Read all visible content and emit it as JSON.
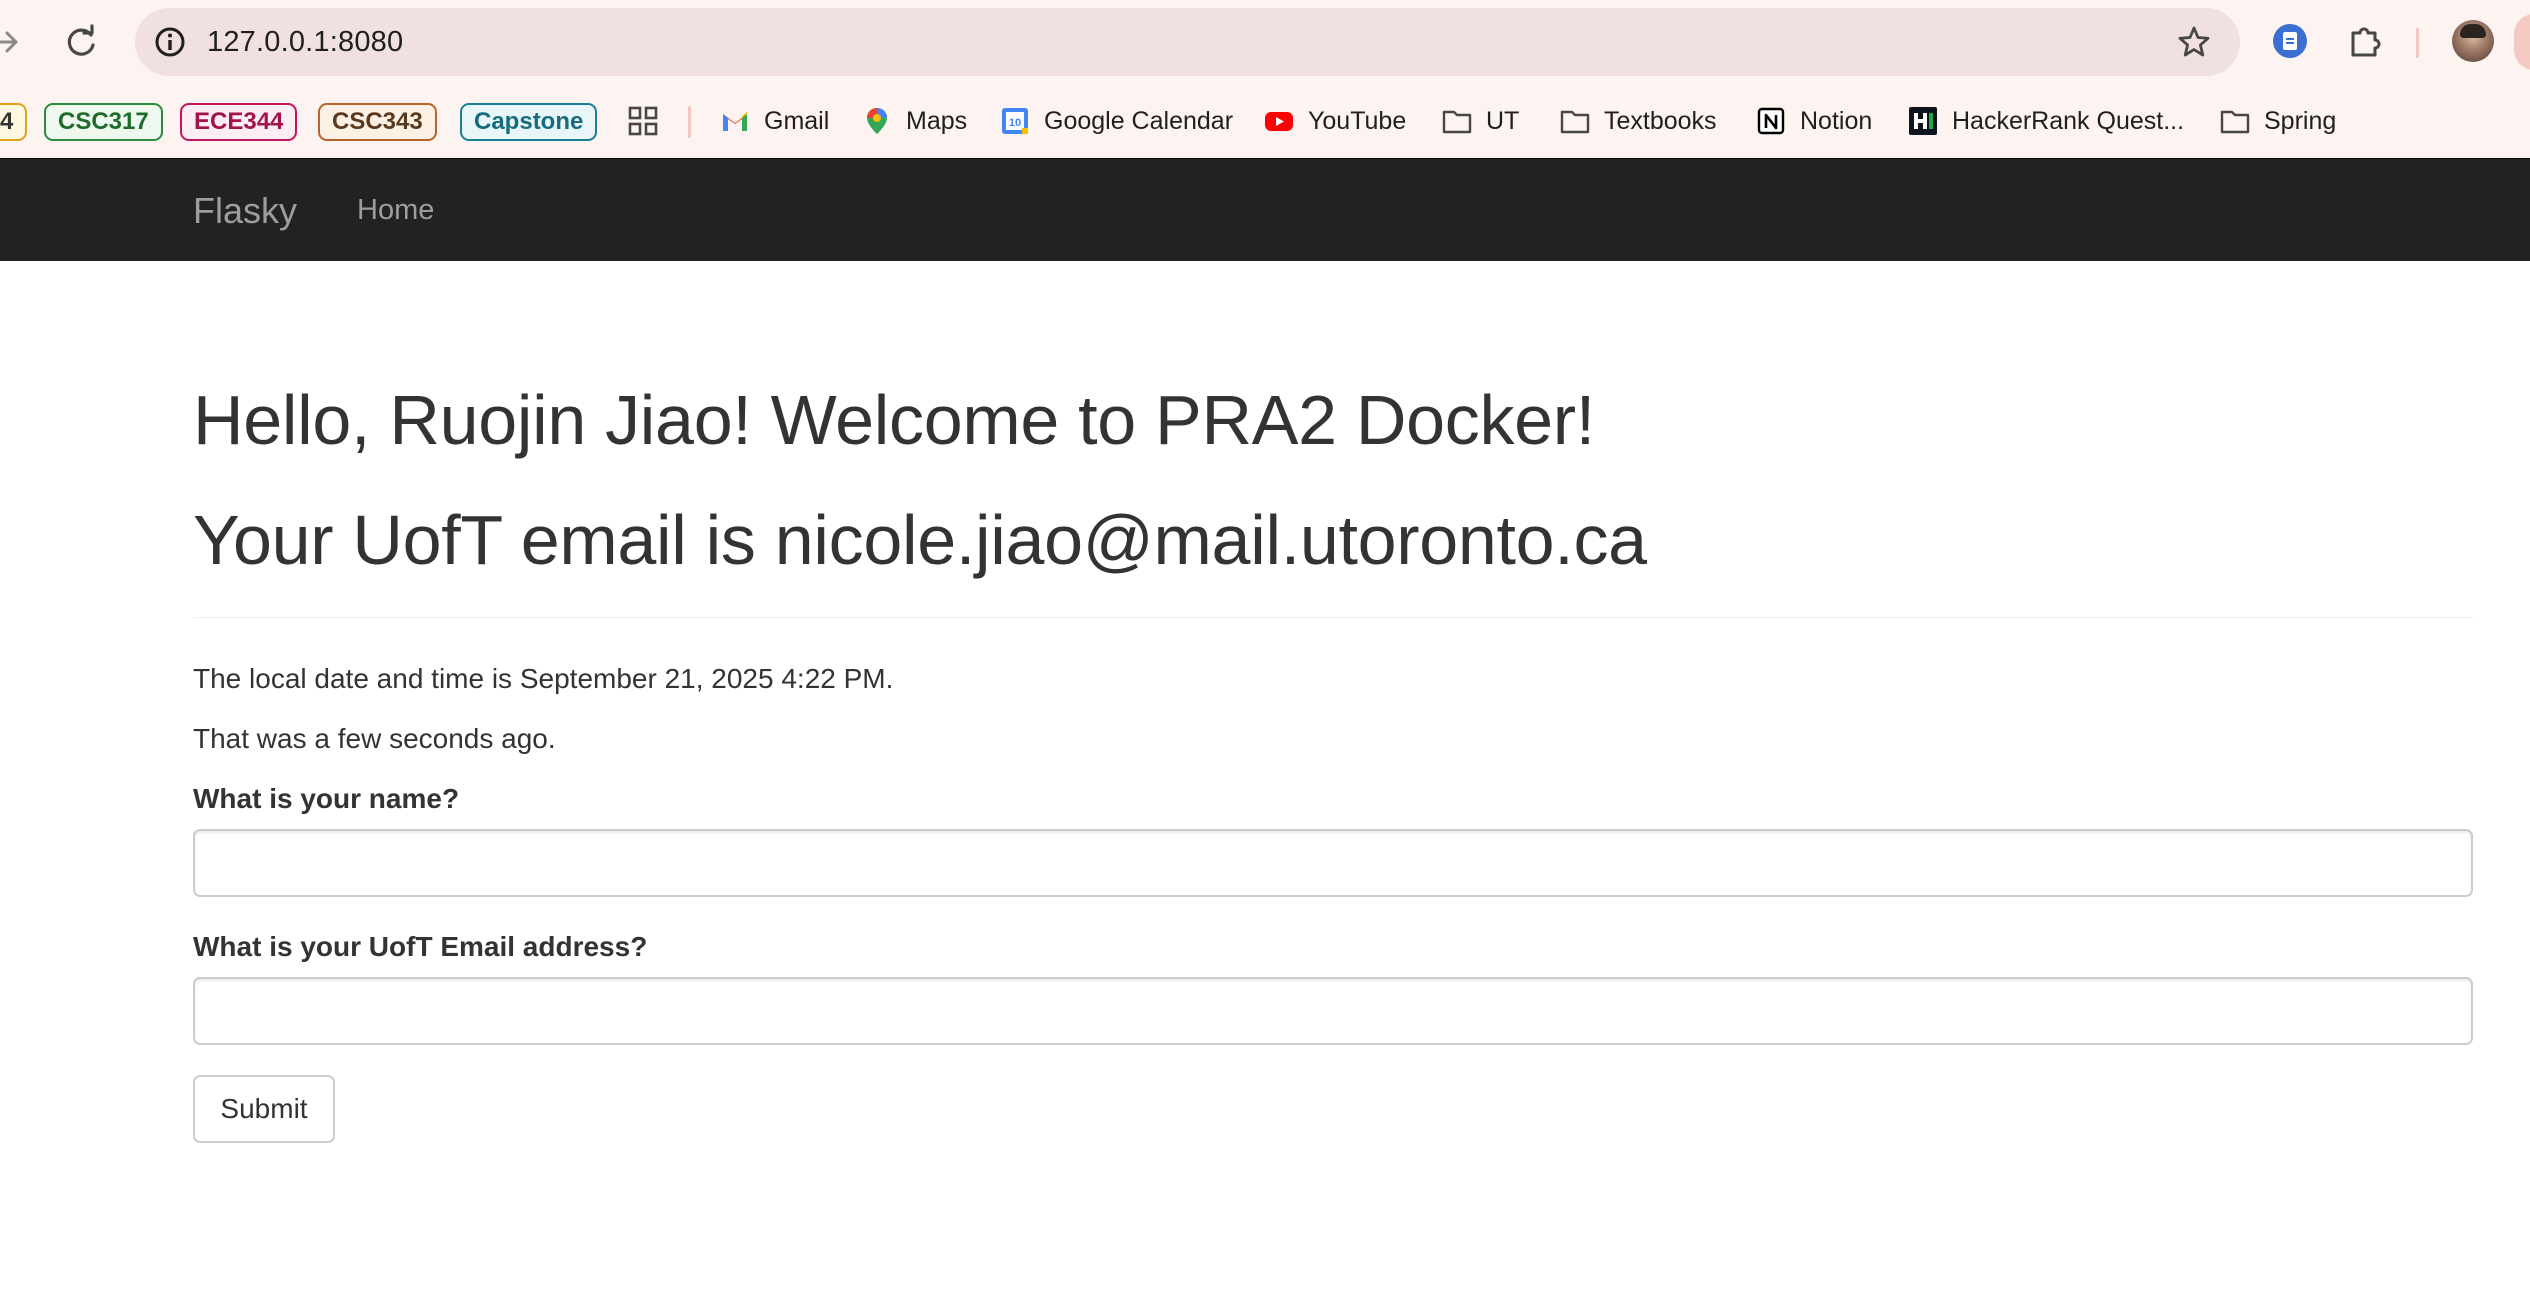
{
  "browser": {
    "url": "127.0.0.1:8080",
    "bookmarks_chips": [
      {
        "label": "4",
        "color": "#e0a21a"
      },
      {
        "label": "CSC317",
        "color": "#2e8b3e"
      },
      {
        "label": "ECE344",
        "color": "#c2185b"
      },
      {
        "label": "CSC343",
        "color": "#b8632a"
      },
      {
        "label": "Capstone",
        "color": "#1a7f94"
      }
    ],
    "bookmarks": [
      {
        "label": "Gmail",
        "icon": "gmail-icon"
      },
      {
        "label": "Maps",
        "icon": "maps-icon"
      },
      {
        "label": "Google Calendar",
        "icon": "calendar-icon"
      },
      {
        "label": "YouTube",
        "icon": "youtube-icon"
      },
      {
        "label": "UT",
        "icon": "folder-icon"
      },
      {
        "label": "Textbooks",
        "icon": "folder-icon"
      },
      {
        "label": "Notion",
        "icon": "notion-icon"
      },
      {
        "label": "HackerRank Quest...",
        "icon": "hackerrank-icon"
      },
      {
        "label": "Spring",
        "icon": "folder-icon"
      }
    ]
  },
  "navbar": {
    "brand": "Flasky",
    "home": "Home",
    "bg_color": "#222222"
  },
  "page": {
    "greeting": "Hello, Ruojin Jiao! Welcome to PRA2 Docker!",
    "email_line": "Your UofT email is nicole.jiao@mail.utoronto.ca",
    "date_text": "The local date and time is September 21, 2025 4:22 PM.",
    "ago_text": "That was a few seconds ago."
  },
  "form": {
    "name_label": "What is your name?",
    "name_value": "",
    "email_label": "What is your UofT Email address?",
    "email_value": "",
    "submit_label": "Submit"
  }
}
